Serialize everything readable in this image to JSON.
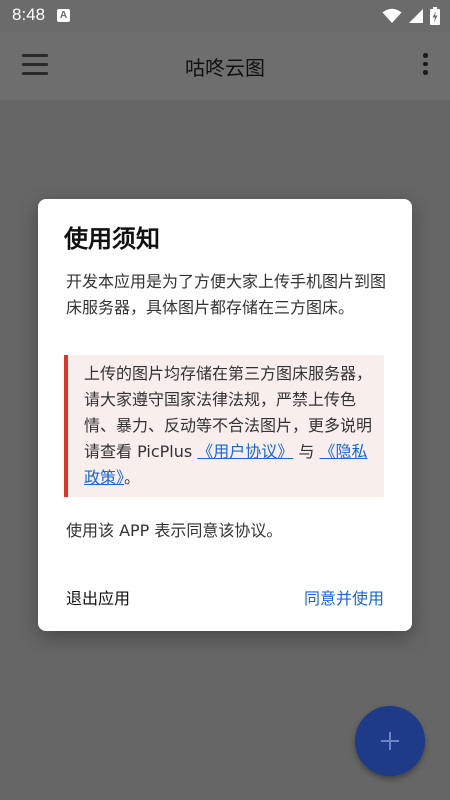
{
  "status_bar": {
    "time": "8:48",
    "notification_icon": "A"
  },
  "app_bar": {
    "title": "咕咚云图"
  },
  "dialog": {
    "title": "使用须知",
    "body": "开发本应用是为了方便大家上传手机图片到图床服务器，具体图片都存储在三方图床。",
    "notice": {
      "text_before": "上传的图片均存储在第三方图床服务器，请大家遵守国家法律法规，严禁上传色情、暴力、反动等不合法图片，更多说明请查看 PicPlus ",
      "user_agreement_link": "《用户协议》",
      "text_between": " 与 ",
      "privacy_policy_link": "《隐私政策》",
      "text_after": "。"
    },
    "accept_text": "使用该 APP 表示同意该协议。",
    "exit_label": "退出应用",
    "agree_label": "同意并使用"
  },
  "colors": {
    "accent": "#1a67d2",
    "fab": "#1d3b86",
    "notice_border": "#d9362e",
    "notice_bg": "#f8eeec"
  },
  "icons": {
    "menu": "hamburger-menu-icon",
    "more": "more-vert-icon",
    "fab": "plus-icon",
    "wifi": "wifi-icon",
    "signal": "signal-icon",
    "battery": "battery-icon"
  }
}
